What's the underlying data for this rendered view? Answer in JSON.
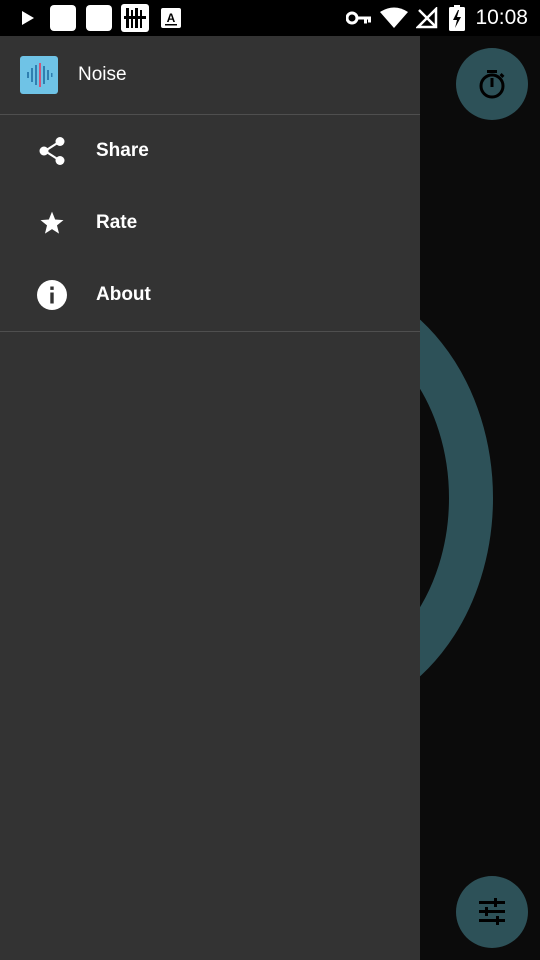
{
  "status_bar": {
    "time": "10:08",
    "left_icons": [
      "play-icon",
      "notification-square-icon",
      "notification-square-icon",
      "barcode-icon",
      "font-a-icon"
    ],
    "right_icons": [
      "vpn-key-icon",
      "wifi-icon",
      "no-signal-icon",
      "battery-charging-icon"
    ]
  },
  "drawer": {
    "app_name": "Noise",
    "logo_icon": "waveform-icon",
    "items": [
      {
        "label": "Share",
        "icon": "share-icon"
      },
      {
        "label": "Rate",
        "icon": "star-icon"
      },
      {
        "label": "About",
        "icon": "info-icon"
      }
    ]
  },
  "background": {
    "accent_color": "#2d5158",
    "drawer_color": "#333333",
    "fabs": [
      {
        "icon": "timer-icon"
      },
      {
        "icon": "tune-icon"
      }
    ]
  }
}
